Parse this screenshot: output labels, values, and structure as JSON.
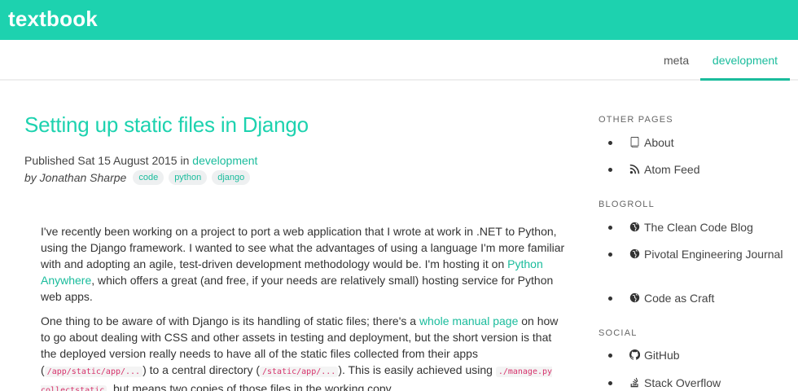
{
  "site": {
    "brand": "textbook"
  },
  "nav": {
    "items": [
      {
        "label": "meta"
      },
      {
        "label": "development"
      }
    ]
  },
  "post": {
    "title": "Setting up static files in Django",
    "published_prefix": "Published Sat 15 August 2015 in",
    "category": "development",
    "author": "by Jonathan Sharpe",
    "tags": [
      "code",
      "python",
      "django"
    ],
    "p1": {
      "t1": "I've recently been working on a project to port a web application that I wrote at work in .NET to Python, using the Django framework. I wanted to see what the advantages of using a language I'm more familiar with and adopting an agile, test-driven development methodology would be. I'm hosting it on",
      "link": "Python Anywhere",
      "t2": ", which offers a great (and free, if your needs are relatively small) hosting service for Python web apps."
    },
    "p2": {
      "t1": "One thing to be aware of with Django is its handling of static files; there's a",
      "link": "whole manual page",
      "t2": "on how to go about dealing with CSS and other assets in testing and deployment, but the short version is that the deployed version really needs to have all of the static files collected from their apps (",
      "code1": "/app/static/app/...",
      "t3": ") to a central directory (",
      "code2": "/static/app/...",
      "t4": "). This is easily achieved using",
      "code3": "./manage.py collectstatic",
      "t5": ", but means two copies of those files in the working copy."
    }
  },
  "sidebar": {
    "other_pages": {
      "heading": "OTHER PAGES",
      "items": [
        {
          "label": "About",
          "icon": "book-icon"
        },
        {
          "label": "Atom Feed",
          "icon": "rss-icon"
        }
      ]
    },
    "blogroll": {
      "heading": "BLOGROLL",
      "items": [
        {
          "label": "The Clean Code Blog",
          "icon": "globe-icon"
        },
        {
          "label": "Pivotal Engineering Journal",
          "icon": "globe-icon"
        },
        {
          "label": "Code as Craft",
          "icon": "globe-icon"
        }
      ]
    },
    "social": {
      "heading": "SOCIAL",
      "items": [
        {
          "label": "GitHub",
          "icon": "github-icon"
        },
        {
          "label": "Stack Overflow",
          "icon": "stack-overflow-icon"
        }
      ]
    }
  },
  "colors": {
    "accent": "#1dd2af",
    "link": "#1abc9c",
    "code": "#d6336c"
  }
}
